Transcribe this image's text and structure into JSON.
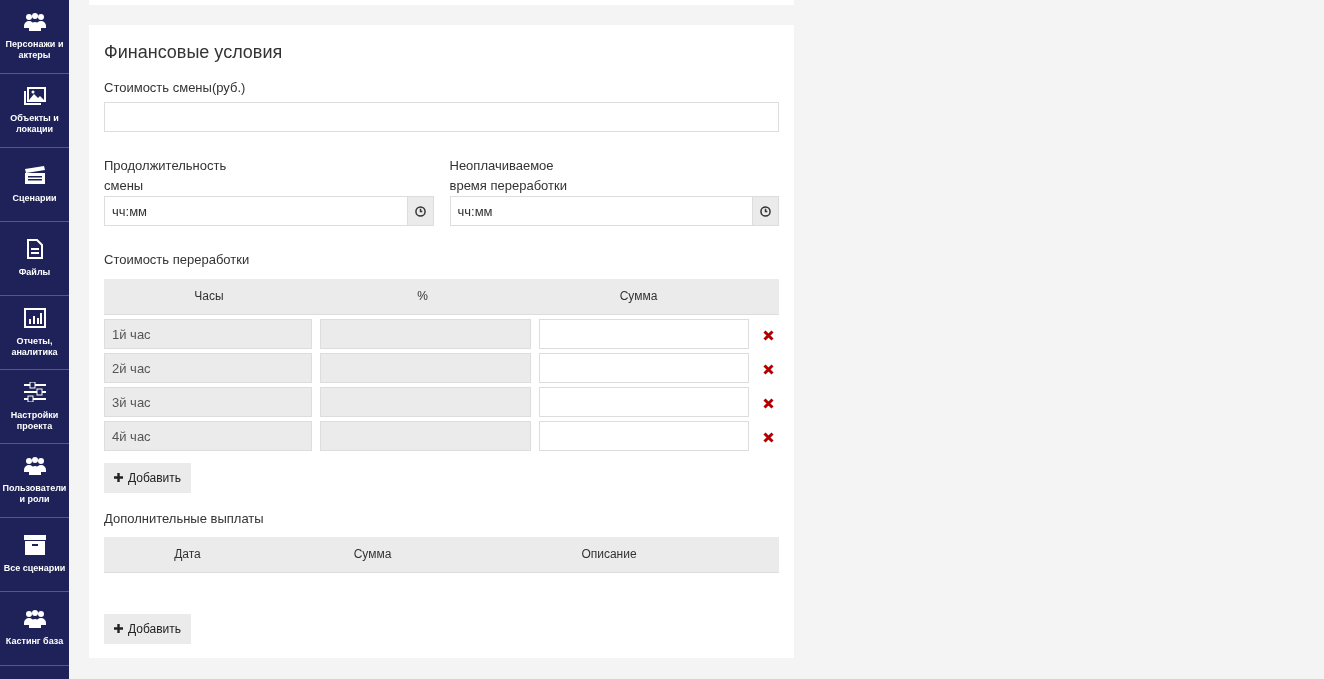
{
  "sidebar": {
    "items": [
      {
        "label": "Персонажи и актеры",
        "kind": "people"
      },
      {
        "label": "Объекты и локации",
        "kind": "images"
      },
      {
        "label": "Сценарии",
        "kind": "clapper"
      },
      {
        "label": "Файлы",
        "kind": "file"
      },
      {
        "label": "Отчеты, аналитика",
        "kind": "chart"
      },
      {
        "label": "Настройки проекта",
        "kind": "sliders"
      },
      {
        "label": "Пользователи и роли",
        "kind": "people"
      },
      {
        "label": "Все сценарии",
        "kind": "archive"
      },
      {
        "label": "Кастинг база",
        "kind": "people"
      }
    ]
  },
  "card": {
    "title": "Финансовые условия",
    "shift_cost": {
      "label": "Стоимость смены(руб.)"
    },
    "time_fields": [
      {
        "label_lines": [
          "Продолжительность",
          "смены"
        ],
        "placeholder": "чч:мм"
      },
      {
        "label_lines": [
          "Неоплачиваемое",
          "время переработки"
        ],
        "placeholder": "чч:мм"
      }
    ],
    "overtime": {
      "title": "Стоимость переработки",
      "columns": [
        "Часы",
        "%",
        "Сумма"
      ],
      "rows": [
        {
          "hours": "1й час"
        },
        {
          "hours": "2й час"
        },
        {
          "hours": "3й час"
        },
        {
          "hours": "4й час"
        }
      ],
      "add_button": "Добавить"
    },
    "extra": {
      "title": "Дополнительные выплаты",
      "columns": [
        "Дата",
        "Сумма",
        "Описание"
      ],
      "add_button": "Добавить"
    }
  }
}
